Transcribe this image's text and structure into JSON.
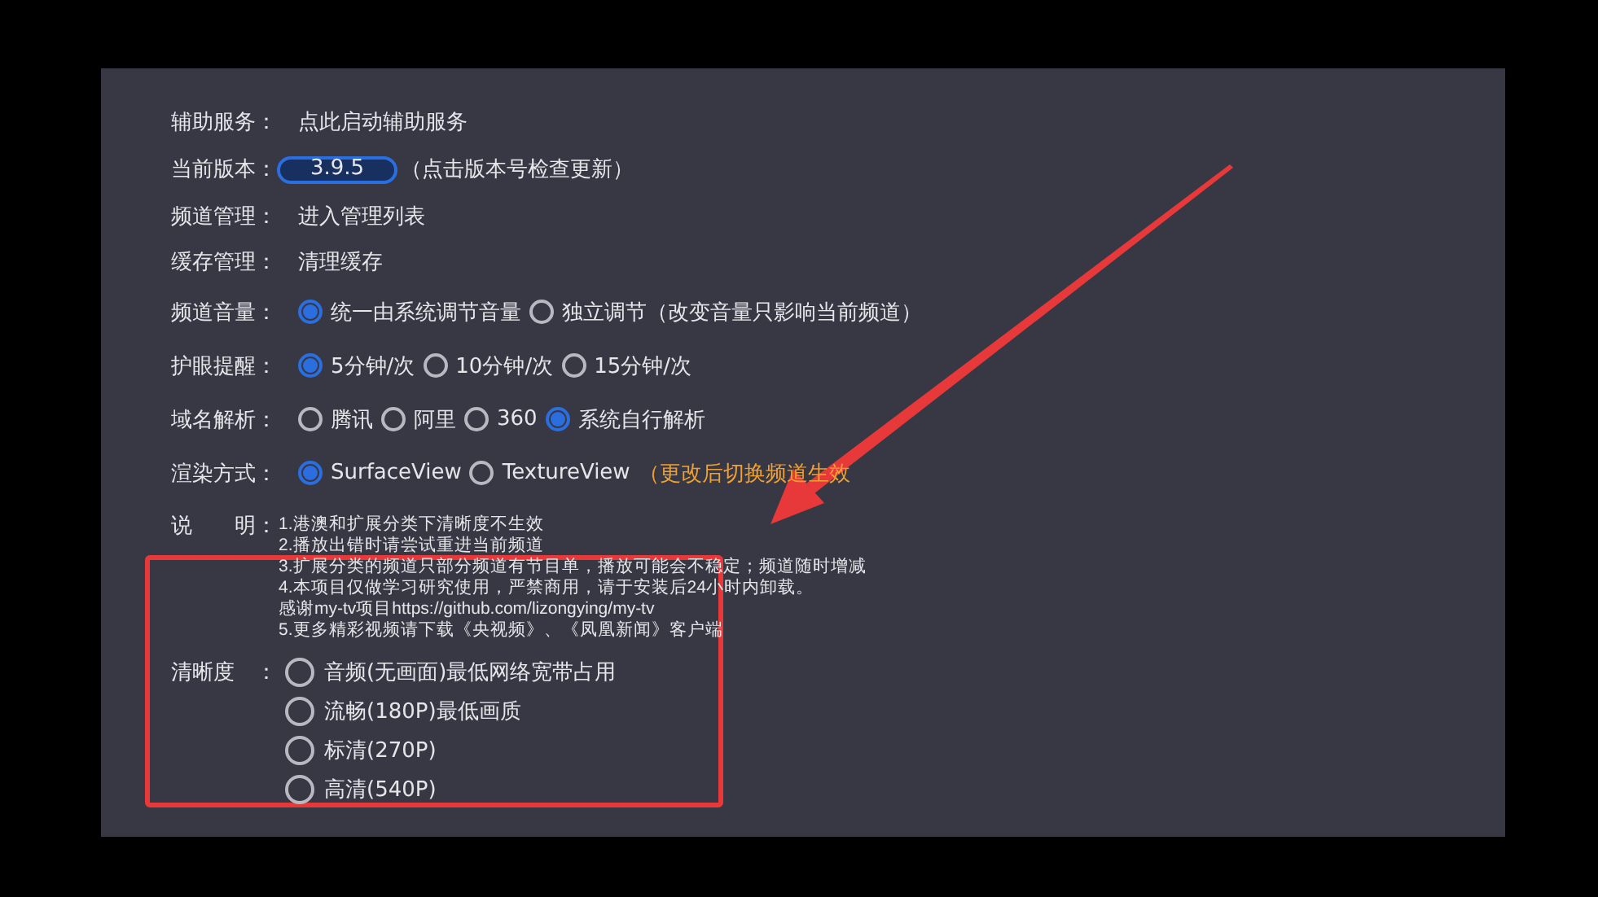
{
  "settings": [
    {
      "kind": "text",
      "label": "辅助服务：",
      "value": "点此启动辅助服务"
    },
    {
      "kind": "version",
      "label": "当前版本：",
      "value": "3.9.5",
      "hint": "（点击版本号检查更新）"
    },
    {
      "kind": "text",
      "label": "频道管理：",
      "value": "进入管理列表"
    },
    {
      "kind": "text",
      "label": "缓存管理：",
      "value": "清理缓存"
    },
    {
      "kind": "radio",
      "label": "频道音量：",
      "options": [
        {
          "label": "统一由系统调节音量",
          "selected": true
        },
        {
          "label": "独立调节（改变音量只影响当前频道）",
          "selected": false
        }
      ]
    },
    {
      "kind": "radio",
      "label": "护眼提醒：",
      "options": [
        {
          "label": "5分钟/次",
          "selected": true
        },
        {
          "label": "10分钟/次",
          "selected": false
        },
        {
          "label": "15分钟/次",
          "selected": false
        }
      ]
    },
    {
      "kind": "radio",
      "label": "域名解析：",
      "options": [
        {
          "label": "腾讯",
          "selected": false
        },
        {
          "label": "阿里",
          "selected": false
        },
        {
          "label": "360",
          "selected": false
        },
        {
          "label": "系统自行解析",
          "selected": true
        }
      ]
    },
    {
      "kind": "radio",
      "label": "渲染方式：",
      "options": [
        {
          "label": "SurfaceView",
          "selected": true
        },
        {
          "label": "TextureView",
          "selected": false
        }
      ],
      "note": "（更改后切换频道生效"
    }
  ],
  "notes": {
    "label": "说　　明：",
    "lines": [
      "1.港澳和扩展分类下清晰度不生效",
      "2.播放出错时请尝试重进当前频道",
      "3.扩展分类的频道只部分频道有节目单，播放可能会不稳定；频道随时增减",
      "4.本项目仅做学习研究使用，严禁商用，请于安装后24小时内卸载。",
      "感谢my-tv项目https://github.com/lizongying/my-tv",
      "5.更多精彩视频请下载《央视频》、《凤凰新闻》客户端"
    ]
  },
  "quality": {
    "label": "清晰度　：",
    "options": [
      {
        "label": "音频(无画面)最低网络宽带占用",
        "selected": false
      },
      {
        "label": "流畅(180P)最低画质",
        "selected": false
      },
      {
        "label": "标清(270P)",
        "selected": false
      },
      {
        "label": "高清(540P)",
        "selected": false
      }
    ]
  }
}
